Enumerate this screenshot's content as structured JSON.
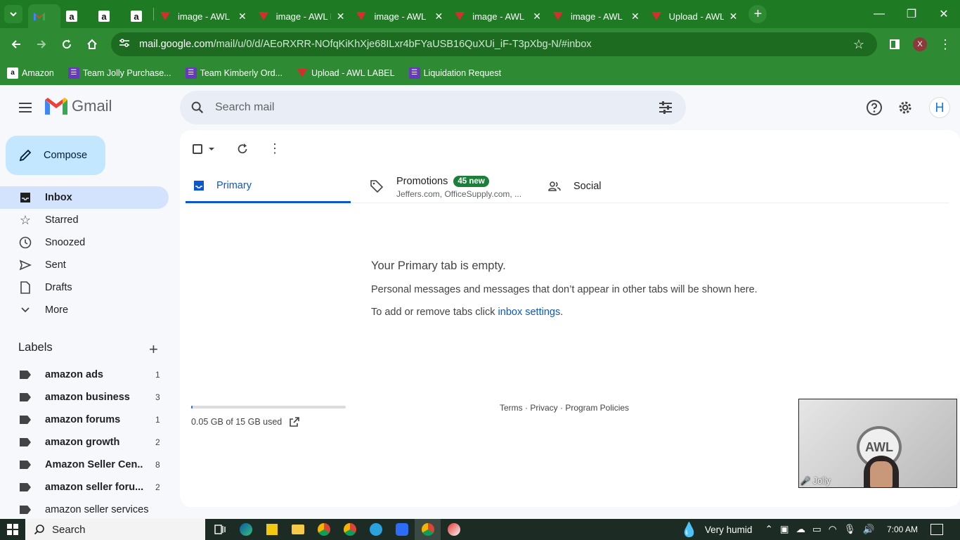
{
  "browser": {
    "tabs": [
      {
        "title": "",
        "favicon": "gmail-icon",
        "active": true
      },
      {
        "title": "",
        "favicon": "amazon-icon"
      },
      {
        "title": "",
        "favicon": "amazon-icon"
      },
      {
        "title": "",
        "favicon": "amazon-icon"
      },
      {
        "title": "image - AWL LA",
        "favicon": "awl-icon"
      },
      {
        "title": "image - AWL LA",
        "favicon": "awl-icon"
      },
      {
        "title": "image - AWL LA",
        "favicon": "awl-icon"
      },
      {
        "title": "image - AWL LA",
        "favicon": "awl-icon"
      },
      {
        "title": "image - AWL LA",
        "favicon": "awl-icon"
      },
      {
        "title": "Upload - AWL L",
        "favicon": "awl-icon"
      }
    ],
    "url_host": "mail.google.com",
    "url_path": "/mail/u/0/d/AEoRXRR-NOfqKiKhXje68ILxr4bFYaUSB16QuXUi_iF-T3pXbg-N/#inbox",
    "profile_initial": "X",
    "bookmarks": [
      {
        "label": "Amazon",
        "icon": "amazon-icon"
      },
      {
        "label": "Team Jolly Purchase...",
        "icon": "list-icon"
      },
      {
        "label": "Team Kimberly Ord...",
        "icon": "list-icon"
      },
      {
        "label": "Upload - AWL LABEL",
        "icon": "awl-icon"
      },
      {
        "label": "Liquidation Request",
        "icon": "list-icon"
      }
    ]
  },
  "gmail": {
    "brand": "Gmail",
    "search_placeholder": "Search mail",
    "avatar_initial": "H",
    "compose_label": "Compose",
    "nav": [
      {
        "label": "Inbox",
        "icon": "inbox-icon",
        "active": true
      },
      {
        "label": "Starred",
        "icon": "star-icon"
      },
      {
        "label": "Snoozed",
        "icon": "clock-icon"
      },
      {
        "label": "Sent",
        "icon": "send-icon"
      },
      {
        "label": "Drafts",
        "icon": "draft-icon"
      },
      {
        "label": "More",
        "icon": "chevron-down-icon"
      }
    ],
    "labels_heading": "Labels",
    "labels": [
      {
        "name": "amazon ads",
        "count": "1"
      },
      {
        "name": "amazon business",
        "count": "3"
      },
      {
        "name": "amazon forums",
        "count": "1"
      },
      {
        "name": "amazon growth",
        "count": "2"
      },
      {
        "name": "Amazon Seller Cen...",
        "count": "8"
      },
      {
        "name": "amazon seller foru...",
        "count": "2"
      },
      {
        "name": "amazon seller services",
        "count": ""
      }
    ],
    "tabs": {
      "primary": "Primary",
      "promotions": "Promotions",
      "promotions_badge": "45 new",
      "promotions_sub": "Jeffers.com, OfficeSupply.com, ...",
      "social": "Social"
    },
    "empty": {
      "title": "Your Primary tab is empty.",
      "line1": "Personal messages and messages that don’t appear in other tabs will be shown here.",
      "line2_prefix": "To add or remove tabs click ",
      "line2_link": "inbox settings",
      "line2_suffix": "."
    },
    "storage": {
      "text": "0.05 GB of 15 GB used",
      "fraction": 0.003
    },
    "footer": "Terms · Privacy · Program Policies",
    "video_name": "Jolly"
  },
  "taskbar": {
    "search_label": "Search",
    "weather": "Very humid",
    "time": "7:00 AM"
  },
  "colors": {
    "chrome_green": "#2e8b33",
    "accent": "#0b57d0",
    "promo_badge": "#188038"
  }
}
